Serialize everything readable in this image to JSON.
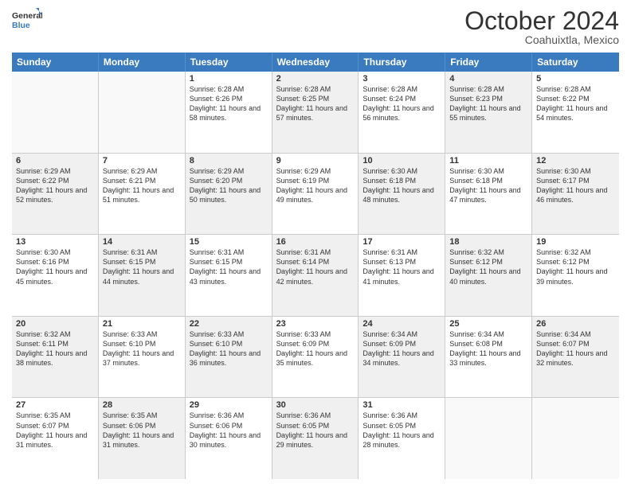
{
  "header": {
    "logo_general": "General",
    "logo_blue": "Blue",
    "month_title": "October 2024",
    "location": "Coahuixtla, Mexico"
  },
  "days_of_week": [
    "Sunday",
    "Monday",
    "Tuesday",
    "Wednesday",
    "Thursday",
    "Friday",
    "Saturday"
  ],
  "weeks": [
    [
      {
        "day": "",
        "sunrise": "",
        "sunset": "",
        "daylight": "",
        "shaded": false,
        "empty": true
      },
      {
        "day": "",
        "sunrise": "",
        "sunset": "",
        "daylight": "",
        "shaded": false,
        "empty": true
      },
      {
        "day": "1",
        "sunrise": "Sunrise: 6:28 AM",
        "sunset": "Sunset: 6:26 PM",
        "daylight": "Daylight: 11 hours and 58 minutes.",
        "shaded": false,
        "empty": false
      },
      {
        "day": "2",
        "sunrise": "Sunrise: 6:28 AM",
        "sunset": "Sunset: 6:25 PM",
        "daylight": "Daylight: 11 hours and 57 minutes.",
        "shaded": true,
        "empty": false
      },
      {
        "day": "3",
        "sunrise": "Sunrise: 6:28 AM",
        "sunset": "Sunset: 6:24 PM",
        "daylight": "Daylight: 11 hours and 56 minutes.",
        "shaded": false,
        "empty": false
      },
      {
        "day": "4",
        "sunrise": "Sunrise: 6:28 AM",
        "sunset": "Sunset: 6:23 PM",
        "daylight": "Daylight: 11 hours and 55 minutes.",
        "shaded": true,
        "empty": false
      },
      {
        "day": "5",
        "sunrise": "Sunrise: 6:28 AM",
        "sunset": "Sunset: 6:22 PM",
        "daylight": "Daylight: 11 hours and 54 minutes.",
        "shaded": false,
        "empty": false
      }
    ],
    [
      {
        "day": "6",
        "sunrise": "Sunrise: 6:29 AM",
        "sunset": "Sunset: 6:22 PM",
        "daylight": "Daylight: 11 hours and 52 minutes.",
        "shaded": true,
        "empty": false
      },
      {
        "day": "7",
        "sunrise": "Sunrise: 6:29 AM",
        "sunset": "Sunset: 6:21 PM",
        "daylight": "Daylight: 11 hours and 51 minutes.",
        "shaded": false,
        "empty": false
      },
      {
        "day": "8",
        "sunrise": "Sunrise: 6:29 AM",
        "sunset": "Sunset: 6:20 PM",
        "daylight": "Daylight: 11 hours and 50 minutes.",
        "shaded": true,
        "empty": false
      },
      {
        "day": "9",
        "sunrise": "Sunrise: 6:29 AM",
        "sunset": "Sunset: 6:19 PM",
        "daylight": "Daylight: 11 hours and 49 minutes.",
        "shaded": false,
        "empty": false
      },
      {
        "day": "10",
        "sunrise": "Sunrise: 6:30 AM",
        "sunset": "Sunset: 6:18 PM",
        "daylight": "Daylight: 11 hours and 48 minutes.",
        "shaded": true,
        "empty": false
      },
      {
        "day": "11",
        "sunrise": "Sunrise: 6:30 AM",
        "sunset": "Sunset: 6:18 PM",
        "daylight": "Daylight: 11 hours and 47 minutes.",
        "shaded": false,
        "empty": false
      },
      {
        "day": "12",
        "sunrise": "Sunrise: 6:30 AM",
        "sunset": "Sunset: 6:17 PM",
        "daylight": "Daylight: 11 hours and 46 minutes.",
        "shaded": true,
        "empty": false
      }
    ],
    [
      {
        "day": "13",
        "sunrise": "Sunrise: 6:30 AM",
        "sunset": "Sunset: 6:16 PM",
        "daylight": "Daylight: 11 hours and 45 minutes.",
        "shaded": false,
        "empty": false
      },
      {
        "day": "14",
        "sunrise": "Sunrise: 6:31 AM",
        "sunset": "Sunset: 6:15 PM",
        "daylight": "Daylight: 11 hours and 44 minutes.",
        "shaded": true,
        "empty": false
      },
      {
        "day": "15",
        "sunrise": "Sunrise: 6:31 AM",
        "sunset": "Sunset: 6:15 PM",
        "daylight": "Daylight: 11 hours and 43 minutes.",
        "shaded": false,
        "empty": false
      },
      {
        "day": "16",
        "sunrise": "Sunrise: 6:31 AM",
        "sunset": "Sunset: 6:14 PM",
        "daylight": "Daylight: 11 hours and 42 minutes.",
        "shaded": true,
        "empty": false
      },
      {
        "day": "17",
        "sunrise": "Sunrise: 6:31 AM",
        "sunset": "Sunset: 6:13 PM",
        "daylight": "Daylight: 11 hours and 41 minutes.",
        "shaded": false,
        "empty": false
      },
      {
        "day": "18",
        "sunrise": "Sunrise: 6:32 AM",
        "sunset": "Sunset: 6:12 PM",
        "daylight": "Daylight: 11 hours and 40 minutes.",
        "shaded": true,
        "empty": false
      },
      {
        "day": "19",
        "sunrise": "Sunrise: 6:32 AM",
        "sunset": "Sunset: 6:12 PM",
        "daylight": "Daylight: 11 hours and 39 minutes.",
        "shaded": false,
        "empty": false
      }
    ],
    [
      {
        "day": "20",
        "sunrise": "Sunrise: 6:32 AM",
        "sunset": "Sunset: 6:11 PM",
        "daylight": "Daylight: 11 hours and 38 minutes.",
        "shaded": true,
        "empty": false
      },
      {
        "day": "21",
        "sunrise": "Sunrise: 6:33 AM",
        "sunset": "Sunset: 6:10 PM",
        "daylight": "Daylight: 11 hours and 37 minutes.",
        "shaded": false,
        "empty": false
      },
      {
        "day": "22",
        "sunrise": "Sunrise: 6:33 AM",
        "sunset": "Sunset: 6:10 PM",
        "daylight": "Daylight: 11 hours and 36 minutes.",
        "shaded": true,
        "empty": false
      },
      {
        "day": "23",
        "sunrise": "Sunrise: 6:33 AM",
        "sunset": "Sunset: 6:09 PM",
        "daylight": "Daylight: 11 hours and 35 minutes.",
        "shaded": false,
        "empty": false
      },
      {
        "day": "24",
        "sunrise": "Sunrise: 6:34 AM",
        "sunset": "Sunset: 6:09 PM",
        "daylight": "Daylight: 11 hours and 34 minutes.",
        "shaded": true,
        "empty": false
      },
      {
        "day": "25",
        "sunrise": "Sunrise: 6:34 AM",
        "sunset": "Sunset: 6:08 PM",
        "daylight": "Daylight: 11 hours and 33 minutes.",
        "shaded": false,
        "empty": false
      },
      {
        "day": "26",
        "sunrise": "Sunrise: 6:34 AM",
        "sunset": "Sunset: 6:07 PM",
        "daylight": "Daylight: 11 hours and 32 minutes.",
        "shaded": true,
        "empty": false
      }
    ],
    [
      {
        "day": "27",
        "sunrise": "Sunrise: 6:35 AM",
        "sunset": "Sunset: 6:07 PM",
        "daylight": "Daylight: 11 hours and 31 minutes.",
        "shaded": false,
        "empty": false
      },
      {
        "day": "28",
        "sunrise": "Sunrise: 6:35 AM",
        "sunset": "Sunset: 6:06 PM",
        "daylight": "Daylight: 11 hours and 31 minutes.",
        "shaded": true,
        "empty": false
      },
      {
        "day": "29",
        "sunrise": "Sunrise: 6:36 AM",
        "sunset": "Sunset: 6:06 PM",
        "daylight": "Daylight: 11 hours and 30 minutes.",
        "shaded": false,
        "empty": false
      },
      {
        "day": "30",
        "sunrise": "Sunrise: 6:36 AM",
        "sunset": "Sunset: 6:05 PM",
        "daylight": "Daylight: 11 hours and 29 minutes.",
        "shaded": true,
        "empty": false
      },
      {
        "day": "31",
        "sunrise": "Sunrise: 6:36 AM",
        "sunset": "Sunset: 6:05 PM",
        "daylight": "Daylight: 11 hours and 28 minutes.",
        "shaded": false,
        "empty": false
      },
      {
        "day": "",
        "sunrise": "",
        "sunset": "",
        "daylight": "",
        "shaded": false,
        "empty": true
      },
      {
        "day": "",
        "sunrise": "",
        "sunset": "",
        "daylight": "",
        "shaded": false,
        "empty": true
      }
    ]
  ]
}
